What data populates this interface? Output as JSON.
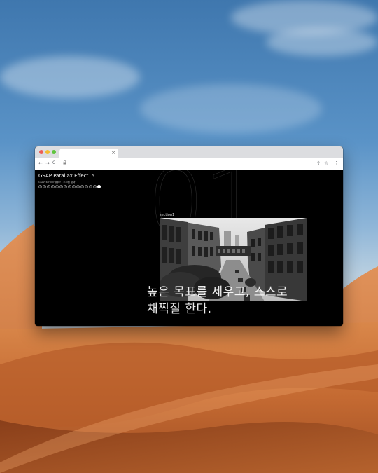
{
  "browser": {
    "tab_title": "",
    "tab_close": "×",
    "address": ""
  },
  "toolbar": {
    "back_icon": "←",
    "forward_icon": "→",
    "reload_icon": "C",
    "lock_icon": "🔒",
    "share_icon": "⇧",
    "bookmark_icon": "☆",
    "menu_icon": "⋮"
  },
  "page": {
    "title": "GSAP Parallax Effect15",
    "subtitle": "GSAP scrollTrigger - 스크롤 효과",
    "big_number": "01",
    "section_label": "section1",
    "headline_line1": "높은 목표를 세우고, 스스로",
    "headline_line2": "채찍질 한다.",
    "nav_dots": [
      "1",
      "2",
      "3",
      "4",
      "5",
      "6",
      "7",
      "8",
      "9",
      "10",
      "11",
      "12",
      "13",
      "14",
      "15"
    ],
    "active_dot": 15
  },
  "colors": {
    "page_background": "#000000",
    "text": "#ffffff",
    "traffic_close": "#ee5d54",
    "traffic_min": "#f5bd2f",
    "traffic_max": "#5fc53f"
  }
}
